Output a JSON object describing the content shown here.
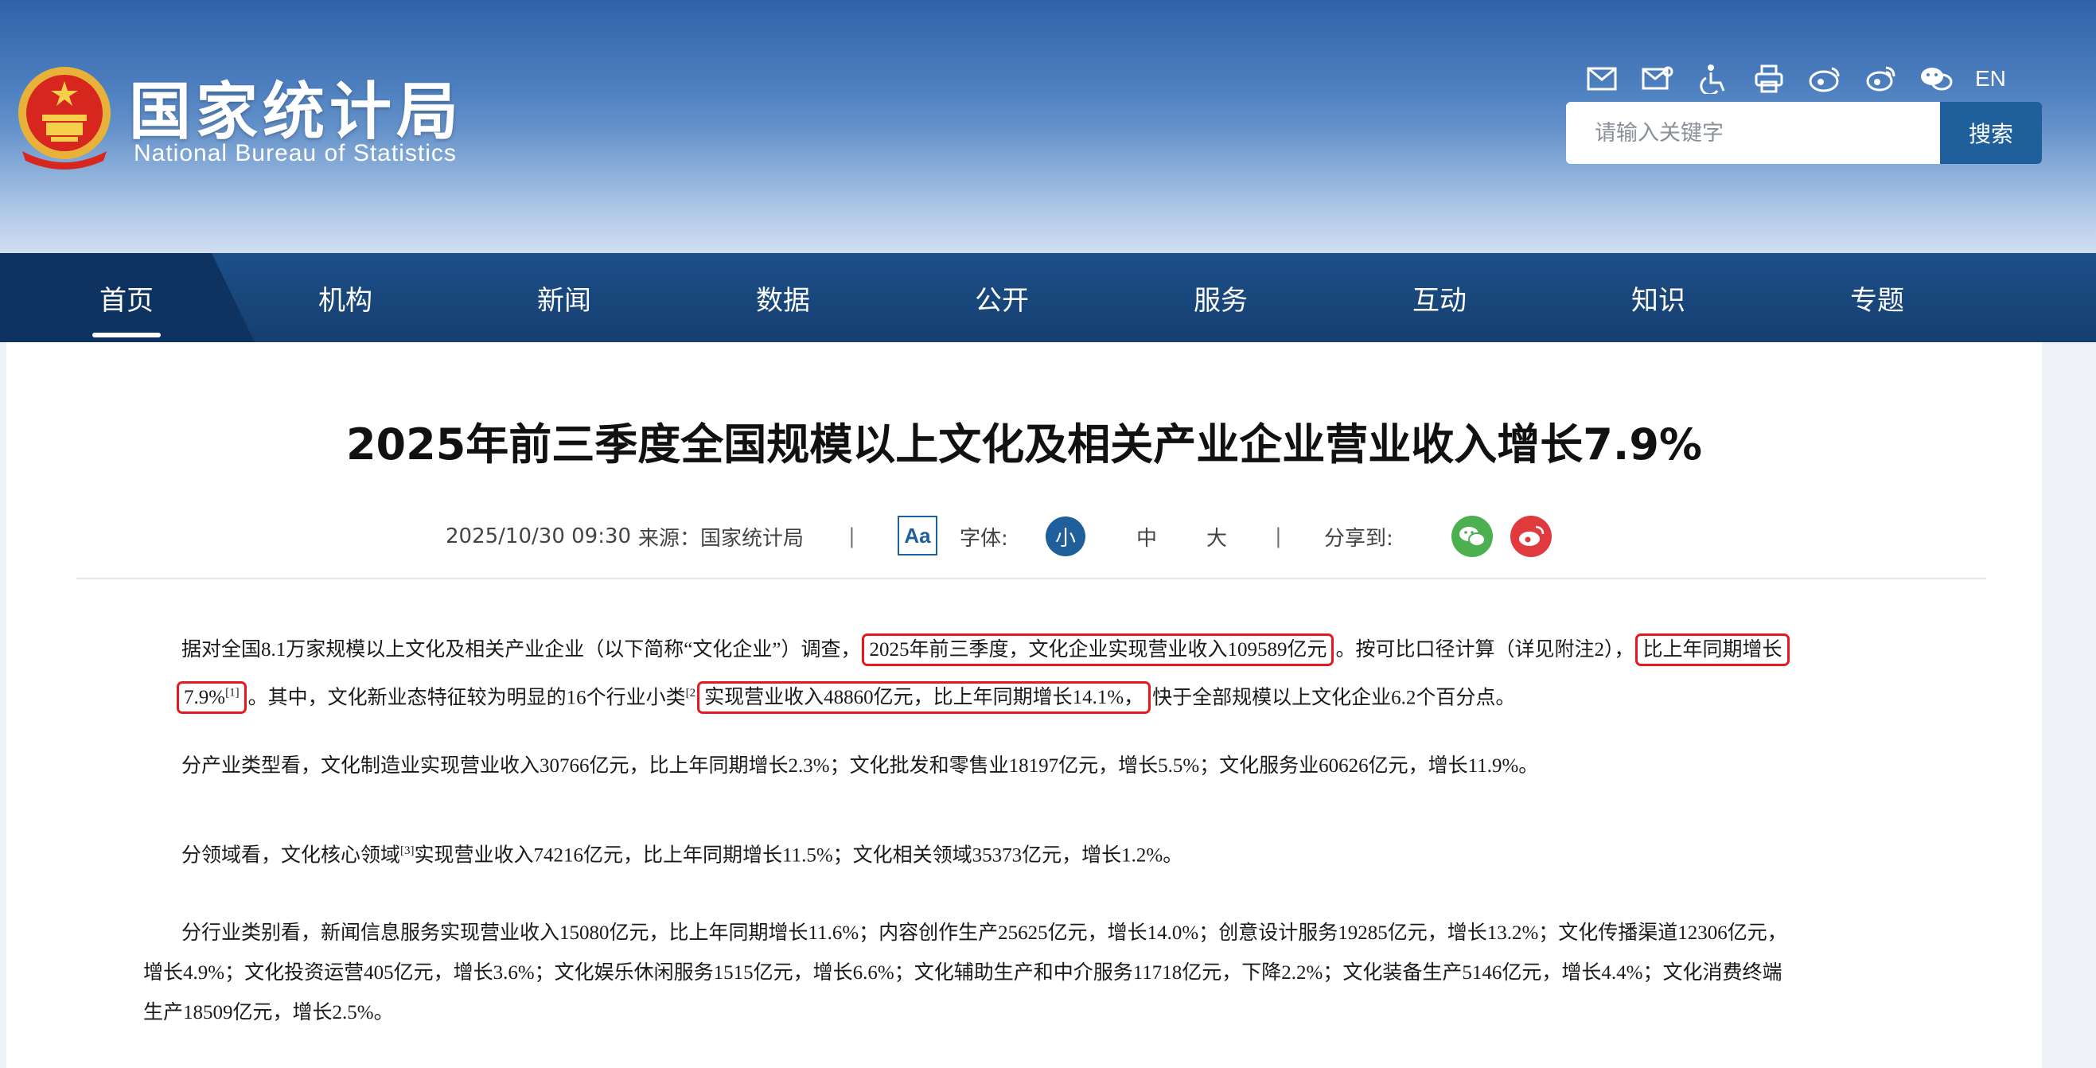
{
  "brand": {
    "name_cn": "国家统计局",
    "name_en": "National Bureau of Statistics"
  },
  "utility": {
    "icons": [
      "mail-icon",
      "message-icon",
      "accessibility-icon",
      "print-icon",
      "weibo-icon",
      "rss-icon",
      "wechat-icon"
    ],
    "lang": "EN"
  },
  "search": {
    "placeholder": "请输入关键字",
    "button": "搜索"
  },
  "nav": {
    "items": [
      "首页",
      "机构",
      "新闻",
      "数据",
      "公开",
      "服务",
      "互动",
      "知识",
      "专题"
    ],
    "active": "首页"
  },
  "article": {
    "title": "2025年前三季度全国规模以上文化及相关产业企业营业收入增长7.9%",
    "datetime": "2025/10/30 09:30",
    "source": "来源：国家统计局",
    "sep": "|",
    "aa": "Aa",
    "font_label": "字体:",
    "sizes": [
      "小",
      "中",
      "大"
    ],
    "share_label": "分享到:",
    "p1": {
      "a": "据对全国8.1万家规模以上文化及相关产业企业（以下简称“文化企业”）调查，",
      "hl1": "2025年前三季度，文化企业实现营业收入109589亿元",
      "b": "。按可比口径计算（详见附注2），",
      "hl2": "比上年同期增长",
      "hl3": "7.9%",
      "sup1": "[1]",
      "c": "。其中，文化新业态特征较为明显的16个行业小类",
      "sup2": "[2",
      "hl4": "实现营业收入48860亿元，比上年同期增长14.1%，",
      "d": "快于全部规模以上文化企业6.2个百分点。"
    },
    "p2": "分产业类型看，文化制造业实现营业收入30766亿元，比上年同期增长2.3%；文化批发和零售业18197亿元，增长5.5%；文化服务业60626亿元，增长11.9%。",
    "p3": {
      "a": "分领域看，文化核心领域",
      "sup": "[3]",
      "b": "实现营业收入74216亿元，比上年同期增长11.5%；文化相关领域35373亿元，增长1.2%。"
    },
    "p4": {
      "line1": "分行业类别看，新闻信息服务实现营业收入15080亿元，比上年同期增长11.6%；内容创作生产25625亿元，增长14.0%；创意设计服务19285亿元，增长13.2%；文化传播渠道12306亿元，",
      "line2": "增长4.9%；文化投资运营405亿元，增长3.6%；文化娱乐休闲服务1515亿元，增长6.6%；文化辅助生产和中介服务11718亿元，下降2.2%；文化装备生产5146亿元，增长4.4%；文化消费终端",
      "line3": "生产18509亿元，增长2.5%。"
    }
  },
  "colors": {
    "brand_blue": "#1f5f9c",
    "nav_bg": "#163f70",
    "highlight_red": "#e5191f",
    "wechat_green": "#4caf50",
    "weibo_red": "#e03a3e"
  }
}
